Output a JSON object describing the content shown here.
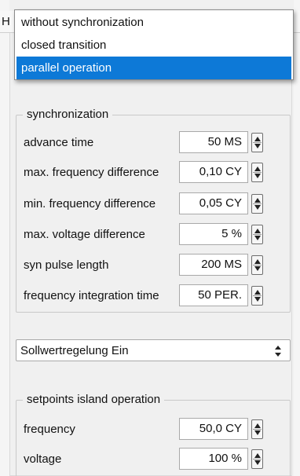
{
  "tab": {
    "label_left": "H",
    "label_right": ""
  },
  "dropdown": {
    "items": [
      {
        "label": "without synchronization"
      },
      {
        "label": "closed transition"
      },
      {
        "label": "parallel operation"
      }
    ],
    "selected_label": "parallel operation"
  },
  "synchronization": {
    "title": "synchronization",
    "fields": [
      {
        "label": "advance time",
        "value": "50 MS"
      },
      {
        "label": "max. frequency difference",
        "value": "0,10 CY"
      },
      {
        "label": "min. frequency difference",
        "value": "0,05 CY"
      },
      {
        "label": "max. voltage difference",
        "value": "5 %"
      },
      {
        "label": "syn pulse length",
        "value": "200 MS"
      },
      {
        "label": "frequency integration time",
        "value": "50 PER."
      }
    ]
  },
  "mode_select": {
    "value": "Sollwertregelung Ein"
  },
  "setpoints": {
    "title": "setpoints island operation",
    "fields": [
      {
        "label": "frequency",
        "value": "50,0 CY"
      },
      {
        "label": "voltage",
        "value": "100 %"
      }
    ]
  },
  "icons": {
    "spinner": "up-down-spinner-icon",
    "select_arrow": "up-down-select-icon"
  },
  "colors": {
    "selection": "#0d79d7",
    "background": "#f0f0f0"
  }
}
